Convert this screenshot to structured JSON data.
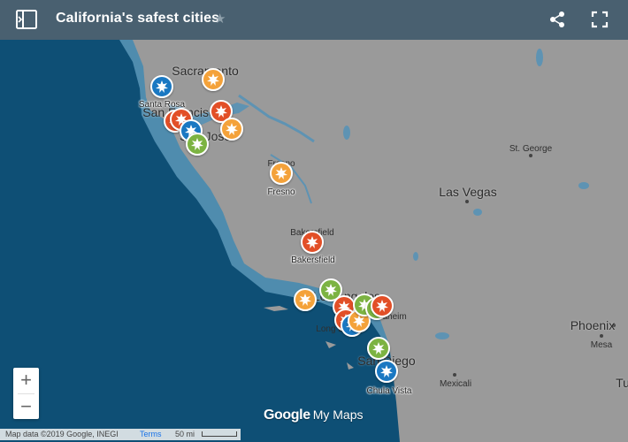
{
  "header": {
    "title": "California's safest cities",
    "panel_icon": "side-panel-icon",
    "star_icon": "star-icon",
    "share_icon": "share-icon",
    "fullscreen_icon": "fullscreen-icon"
  },
  "map": {
    "colors": {
      "ocean": "#0e4f75",
      "land": "#9a9a9a",
      "water": "#5e93b3",
      "shelf": "#4f8cae"
    },
    "place_labels": {
      "sacramento": "Sacramento",
      "san_francisco": "San Francisco",
      "san_jose": "San Jose",
      "fresno_big": "Fresno",
      "bakersfield_big": "Bakersfield",
      "los_angeles": "Los Angeles",
      "long_beach": "Long Beach",
      "anaheim": "Anaheim",
      "san_diego": "San Diego",
      "las_vegas": "Las Vegas",
      "phoenix": "Phoenix",
      "st_george": "St. George",
      "mesa": "Mesa",
      "mexicali": "Mexicali",
      "tucson": "Tu"
    },
    "pin_colors": {
      "blue": "#1a78c2",
      "orange": "#f4a23a",
      "red": "#e24f27",
      "green": "#7cb342"
    },
    "marker_labels": {
      "santa_rosa": "Santa Rosa",
      "fresno": "Fresno",
      "bakersfield": "Bakersfield",
      "chula_vista": "Chula Vista"
    }
  },
  "controls": {
    "zoom_in": "+",
    "zoom_out": "−"
  },
  "branding": {
    "google": "Google",
    "product": "My Maps"
  },
  "footer": {
    "attribution": "Map data ©2019 Google, INEGI",
    "terms": "Terms",
    "scale": "50 mi"
  }
}
